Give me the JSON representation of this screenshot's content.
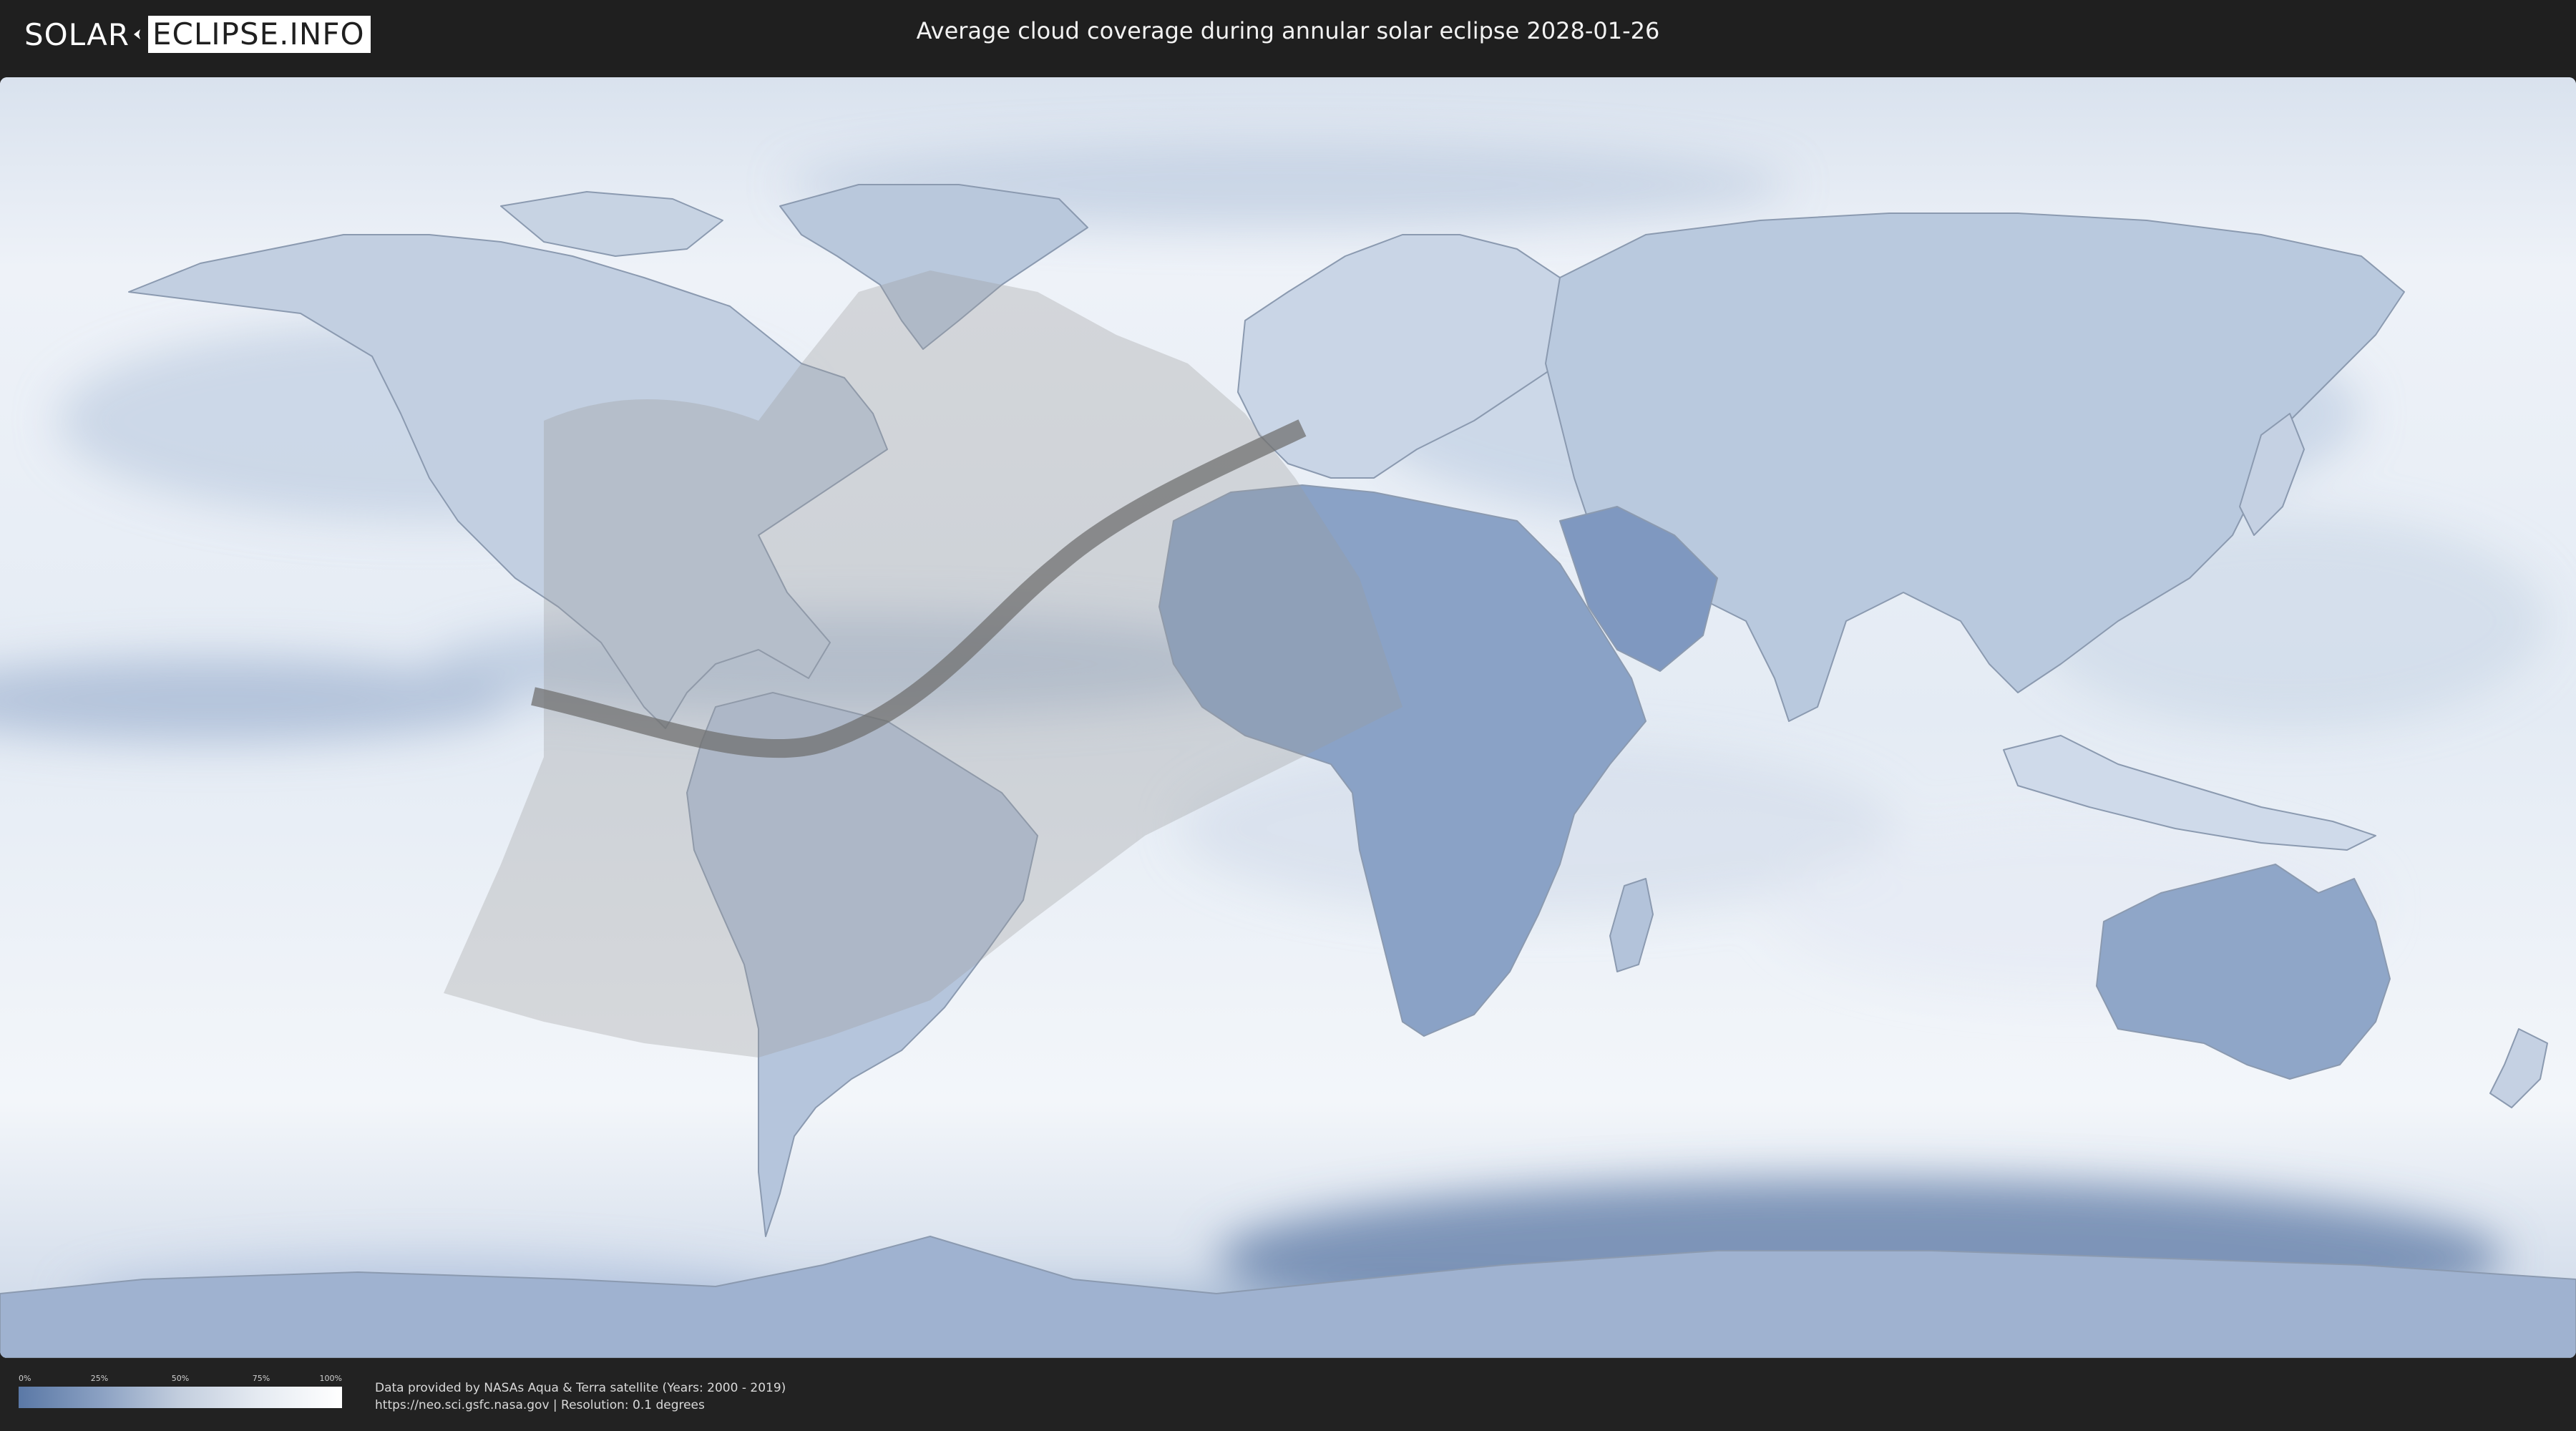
{
  "header": {
    "logo_left": "SOLAR",
    "logo_right": "ECLIPSE.INFO",
    "title": "Average cloud coverage during annular solar eclipse 2028-01-26"
  },
  "map": {
    "projection": "equirectangular",
    "colors": {
      "clear_sky": "#4f6f9f",
      "full_cloud": "#ffffff",
      "eclipse_overlay": "#9a9a9a",
      "annular_path": "#6e6e6e",
      "borders": "#8b9ab0"
    }
  },
  "legend": {
    "ticks": [
      "0%",
      "25%",
      "50%",
      "75%",
      "100%"
    ],
    "from_color": "#5a78a6",
    "to_color": "#ffffff"
  },
  "credits": {
    "line1": "Data provided by NASAs Aqua & Terra satellite (Years: 2000 - 2019)",
    "line2": "https://neo.sci.gsfc.nasa.gov | Resolution: 0.1 degrees"
  }
}
